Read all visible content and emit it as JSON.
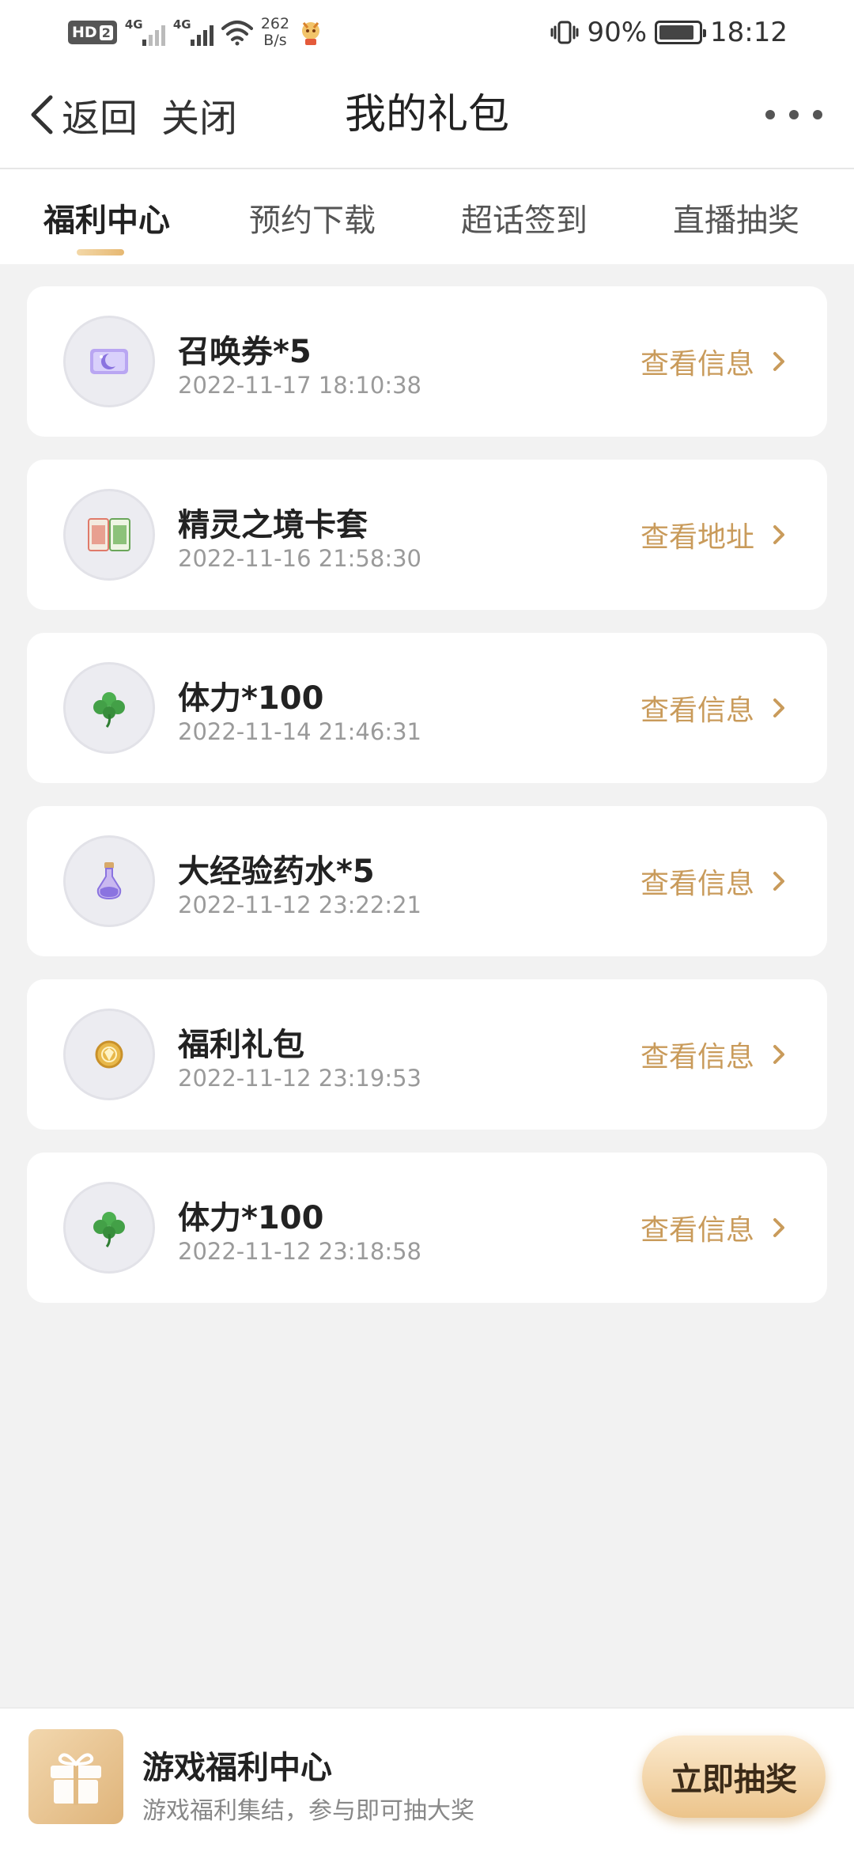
{
  "status_bar": {
    "hd": "HD",
    "sim": "2",
    "net1": "4G",
    "net2": "4G",
    "speed_value": "262",
    "speed_unit": "B/s",
    "battery": "90%",
    "battery_level": 0.9,
    "time": "18:12"
  },
  "nav": {
    "back_label": "返回",
    "close_label": "关闭",
    "title": "我的礼包",
    "more_icon": "more-dots-icon"
  },
  "tabs": [
    {
      "label": "福利中心",
      "active": true
    },
    {
      "label": "预约下载",
      "active": false
    },
    {
      "label": "超话签到",
      "active": false
    },
    {
      "label": "直播抽奖",
      "active": false
    }
  ],
  "gifts": [
    {
      "title": "召唤券*5",
      "date": "2022-11-17 18:10:38",
      "action": "查看信息",
      "icon": "ticket-icon"
    },
    {
      "title": "精灵之境卡套",
      "date": "2022-11-16 21:58:30",
      "action": "查看地址",
      "icon": "card-sleeve-icon"
    },
    {
      "title": "体力*100",
      "date": "2022-11-14 21:46:31",
      "action": "查看信息",
      "icon": "clover-icon"
    },
    {
      "title": "大经验药水*5",
      "date": "2022-11-12 23:22:21",
      "action": "查看信息",
      "icon": "potion-icon"
    },
    {
      "title": "福利礼包",
      "date": "2022-11-12 23:19:53",
      "action": "查看信息",
      "icon": "coin-icon"
    },
    {
      "title": "体力*100",
      "date": "2022-11-12 23:18:58",
      "action": "查看信息",
      "icon": "clover-icon"
    }
  ],
  "banner": {
    "title": "游戏福利中心",
    "subtitle": "游戏福利集结，参与即可抽大奖",
    "button_label": "立即抽奖",
    "icon": "gift-icon"
  },
  "colors": {
    "accent_gold": "#c99b5b",
    "background": "#f2f2f2",
    "button_gradient_top": "#fbe9cd",
    "button_gradient_bottom": "#ecc48b"
  }
}
